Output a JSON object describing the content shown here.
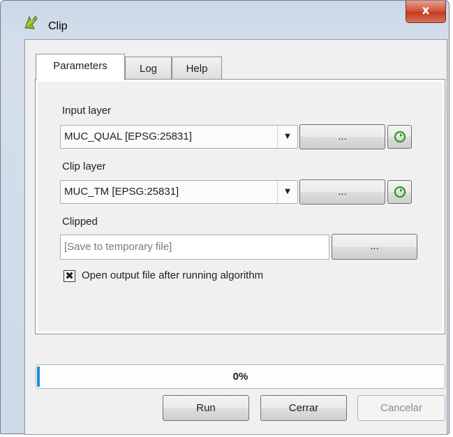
{
  "window": {
    "title": "Clip",
    "close_glyph": "x"
  },
  "tabs": [
    {
      "label": "Parameters",
      "active": true
    },
    {
      "label": "Log",
      "active": false
    },
    {
      "label": "Help",
      "active": false
    }
  ],
  "params": {
    "input_layer": {
      "label": "Input layer",
      "value": "MUC_QUAL [EPSG:25831]",
      "browse": "...",
      "dropdown_glyph": "▼"
    },
    "clip_layer": {
      "label": "Clip layer",
      "value": "MUC_TM [EPSG:25831]",
      "browse": "...",
      "dropdown_glyph": "▼"
    },
    "clipped": {
      "label": "Clipped",
      "placeholder": "[Save to temporary file]",
      "browse": "..."
    },
    "open_output": {
      "label": "Open output file after running algorithm",
      "checked": true,
      "mark": "✖"
    }
  },
  "progress": {
    "percent": 0,
    "text": "0%",
    "color": "#1f8fd6"
  },
  "buttons": {
    "run": "Run",
    "close": "Cerrar",
    "cancel": "Cancelar"
  },
  "icons": {
    "title": "qgis-clip-icon",
    "iterate": "green-iterate-icon"
  }
}
